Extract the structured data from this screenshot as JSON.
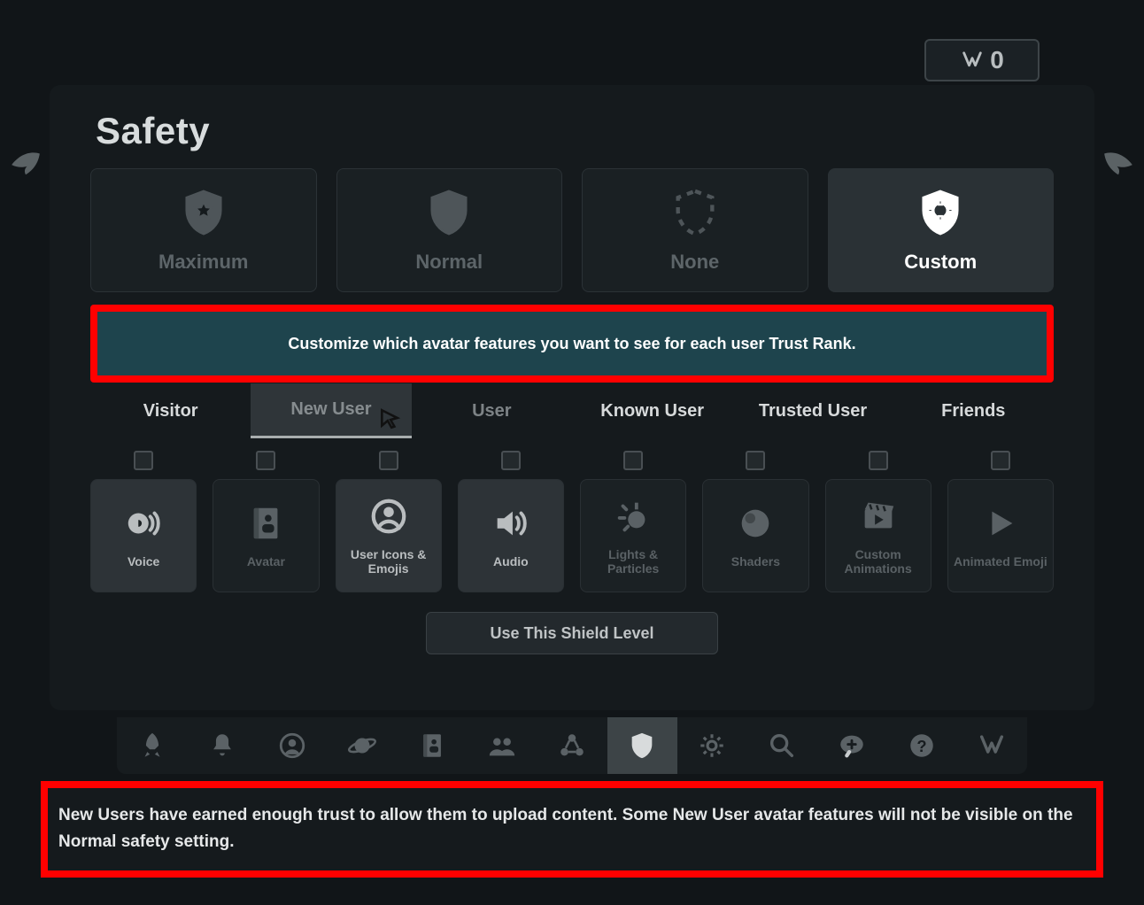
{
  "header": {
    "currency_symbol": "V",
    "currency_value": "0"
  },
  "panel": {
    "title": "Safety",
    "levels": [
      {
        "id": "maximum",
        "label": "Maximum",
        "icon": "shield-star-icon",
        "selected": false
      },
      {
        "id": "normal",
        "label": "Normal",
        "icon": "shield-icon",
        "selected": false
      },
      {
        "id": "none",
        "label": "None",
        "icon": "shield-dashed-icon",
        "selected": false
      },
      {
        "id": "custom",
        "label": "Custom",
        "icon": "shield-gear-icon",
        "selected": true
      }
    ],
    "level_description": "Customize which avatar features you want to see for each user Trust Rank.",
    "ranks": [
      {
        "id": "visitor",
        "label": "Visitor",
        "active": false
      },
      {
        "id": "new-user",
        "label": "New User",
        "active": true
      },
      {
        "id": "user",
        "label": "User",
        "active": false
      },
      {
        "id": "known-user",
        "label": "Known User",
        "active": false
      },
      {
        "id": "trusted-user",
        "label": "Trusted User",
        "active": false
      },
      {
        "id": "friends",
        "label": "Friends",
        "active": false
      }
    ],
    "features": [
      {
        "id": "voice",
        "label": "Voice",
        "icon": "voice-icon",
        "enabled": true,
        "checked": false
      },
      {
        "id": "avatar",
        "label": "Avatar",
        "icon": "avatar-book-icon",
        "enabled": false,
        "checked": false
      },
      {
        "id": "user-icons-emojis",
        "label": "User Icons & Emojis",
        "icon": "user-circle-icon",
        "enabled": true,
        "checked": false
      },
      {
        "id": "audio",
        "label": "Audio",
        "icon": "audio-icon",
        "enabled": true,
        "checked": false
      },
      {
        "id": "lights-particles",
        "label": "Lights & Particles",
        "icon": "sparkle-icon",
        "enabled": false,
        "checked": false
      },
      {
        "id": "shaders",
        "label": "Shaders",
        "icon": "sphere-icon",
        "enabled": false,
        "checked": false
      },
      {
        "id": "custom-animations",
        "label": "Custom Animations",
        "icon": "clapper-icon",
        "enabled": false,
        "checked": false
      },
      {
        "id": "animated-emoji",
        "label": "Animated Emoji",
        "icon": "play-icon",
        "enabled": false,
        "checked": false
      }
    ],
    "use_button_label": "Use This Shield Level"
  },
  "toolbar": {
    "items": [
      {
        "id": "launch",
        "icon": "rocket-icon",
        "active": false
      },
      {
        "id": "alerts",
        "icon": "bell-icon",
        "active": false
      },
      {
        "id": "profile",
        "icon": "user-icon",
        "active": false
      },
      {
        "id": "worlds",
        "icon": "planet-icon",
        "active": false
      },
      {
        "id": "avatars",
        "icon": "book-icon",
        "active": false
      },
      {
        "id": "social",
        "icon": "group-icon",
        "active": false
      },
      {
        "id": "network",
        "icon": "nodes-icon",
        "active": false
      },
      {
        "id": "safety",
        "icon": "shield-icon",
        "active": true
      },
      {
        "id": "settings",
        "icon": "gear-icon",
        "active": false
      },
      {
        "id": "search",
        "icon": "search-icon",
        "active": false
      },
      {
        "id": "chat",
        "icon": "chat-plus-icon",
        "active": false
      },
      {
        "id": "help",
        "icon": "help-icon",
        "active": false
      },
      {
        "id": "vrchat",
        "icon": "logo-icon",
        "active": false
      }
    ]
  },
  "footer": {
    "text": "New Users have earned enough trust to allow them to upload content. Some New User avatar features will not be visible on the Normal safety setting."
  },
  "colors": {
    "highlight_border": "#ff0000",
    "desc_bg": "#1e444d",
    "panel_bg": "#151a1d",
    "selected_bg": "#2a3135"
  }
}
